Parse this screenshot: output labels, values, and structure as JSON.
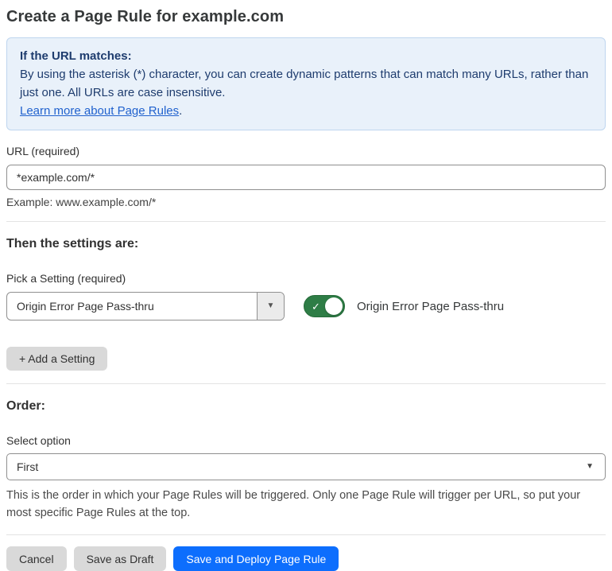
{
  "page": {
    "title": "Create a Page Rule for example.com"
  },
  "info_box": {
    "heading": "If the URL matches:",
    "body": "By using the asterisk (*) character, you can create dynamic patterns that can match many URLs, rather than just one. All URLs are case insensitive.",
    "link_label": "Learn more about Page Rules",
    "link_suffix": "."
  },
  "url_field": {
    "label": "URL (required)",
    "value": "*example.com/*",
    "helper": "Example: www.example.com/*"
  },
  "settings_section": {
    "heading": "Then the settings are:",
    "picker_label": "Pick a Setting (required)",
    "picker_value": "Origin Error Page Pass-thru",
    "toggle_state": "on",
    "toggle_label": "Origin Error Page Pass-thru",
    "add_setting_label": "+ Add a Setting"
  },
  "order_section": {
    "heading": "Order:",
    "select_label": "Select option",
    "select_value": "First",
    "helper": "This is the order in which your Page Rules will be triggered. Only one Page Rule will trigger per URL, so put your most specific Page Rules at the top."
  },
  "footer": {
    "cancel_label": "Cancel",
    "save_draft_label": "Save as Draft",
    "save_deploy_label": "Save and Deploy Page Rule"
  },
  "icons": {
    "caret_down": "▼",
    "check": "✓"
  },
  "colors": {
    "accent_blue": "#0d6efd",
    "toggle_green": "#2e7d46",
    "info_bg": "#e9f1fa",
    "info_border": "#bfd6ef",
    "info_text": "#1e3c6e",
    "link_blue": "#2162ce",
    "button_gray": "#d9d9d9"
  }
}
